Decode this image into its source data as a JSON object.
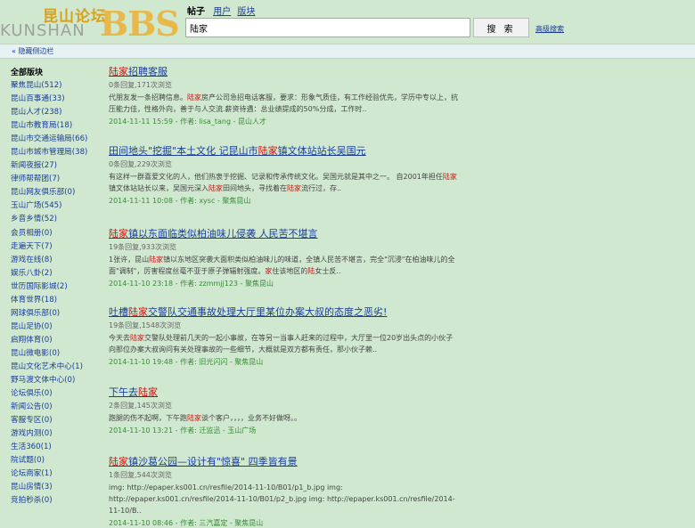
{
  "logo": {
    "cn": "昆山论坛",
    "en": "KUNSHAN",
    "bbs": "BBS"
  },
  "search": {
    "tab_active": "帖子",
    "tab_users": "用户",
    "tab_sections": "版块",
    "query": "陆家",
    "button_label": "搜 索",
    "advanced_label": "高级搜索"
  },
  "toggle": {
    "label": "« 隐藏侧边栏"
  },
  "sidebar": {
    "heading": "全部版块",
    "items": [
      "聚焦昆山(512)",
      "昆山百事通(33)",
      "昆山人才(238)",
      "昆山市教育局(18)",
      "昆山市交通运输局(66)",
      "昆山市城市管理局(38)",
      "新闻夜报(27)",
      "律师帮帮团(7)",
      "昆山网友俱乐部(0)",
      "玉山广场(545)",
      "乡音乡情(52)",
      "会员相册(0)",
      "走遍天下(7)",
      "游戏在线(8)",
      "娱乐八卦(2)",
      "世历国际影城(2)",
      "体育世界(18)",
      "网球俱乐部(0)",
      "昆山足协(0)",
      "启翔体育(0)",
      "昆山微电影(0)",
      "昆山文化艺术中心(1)",
      "野马渡文体中心(0)",
      "论坛俱乐(0)",
      "新闻公告(0)",
      "客服专区(0)",
      "游戏内测(0)",
      "生活360(1)",
      "院试题(0)",
      "论坛商家(1)",
      "昆山房情(3)",
      "竞拍秒杀(0)"
    ]
  },
  "results": [
    {
      "title_hl": "陆家",
      "title_rest": "招聘客服",
      "meta": "0条回复,171次浏览",
      "snippet": [
        {
          "t": "代朋友发一条招聘信息。"
        },
        {
          "t": "陆家",
          "hl": true
        },
        {
          "t": "房产公司急招电话客服，要求：形象气质佳，有工作经验优先，学历中专以上，抗压能力佳，性格外向，善于与人交流.薪资待遇：总业绩提成的50%分成，工作时.."
        }
      ],
      "date": "2014-11-11 15:59",
      "author": "作者: lisa_tang - 昆山人才"
    },
    {
      "title_pre": "田间地头\"挖掘\"本土文化 记昆山市",
      "title_hl": "陆家",
      "title_rest": "镇文体站站长吴国元",
      "meta": "0条回复,229次浏览",
      "snippet": [
        {
          "t": "有这样一群喜爱文化的人，他们热衷于挖掘、记录和传承传统文化。吴国元就是其中之一。        自2001年担任"
        },
        {
          "t": "陆家",
          "hl": true
        },
        {
          "t": "镇文体站站长以来，吴国元深入"
        },
        {
          "t": "陆家",
          "hl": true
        },
        {
          "t": "田间地头，寻找着在"
        },
        {
          "t": "陆家",
          "hl": true
        },
        {
          "t": "流行过，存.."
        }
      ],
      "date": "2014-11-11 10:08",
      "author": "作者: xysc - 聚焦昆山"
    },
    {
      "title_hl": "陆家",
      "title_rest": "镇以东面临类似柏油味儿侵袭 人民苦不堪言",
      "meta": "19条回复,933次浏览",
      "snippet": [
        {
          "t": "1张许，昆山"
        },
        {
          "t": "陆家",
          "hl": true
        },
        {
          "t": "镇以东地区突袭大面积类似柏油味儿的味道，全镇人民苦不堪言，完全\"沉浸\"在柏油味儿的全面\"调制\"，厉害程度丝毫不亚于原子弹辐射强度。"
        },
        {
          "t": "家",
          "hl": true
        },
        {
          "t": "住该地区的"
        },
        {
          "t": "陆",
          "hl": true
        },
        {
          "t": "女士反.."
        }
      ],
      "date": "2014-11-10 23:18",
      "author": "作者: zzmmjj123 - 聚焦昆山"
    },
    {
      "title_pre": "吐槽",
      "title_hl": "陆家",
      "title_rest": "交警队交通事故处理大厅里某位办案大叔的态度之恶劣!",
      "meta": "19条回复,1548次浏览",
      "snippet": [
        {
          "t": "今天去"
        },
        {
          "t": "陆家",
          "hl": true
        },
        {
          "t": "交警队处理前几天的一起小事故，在等另一当事人赶来的过程中，大厅里一位20岁出头点的小伙子向那位办案大叔询问有关处理事故的一些细节，大概就是双方都有责任，那小伙子赖.."
        }
      ],
      "date": "2014-11-10 19:48",
      "author": "作者: 旧光闪闪 - 聚焦昆山"
    },
    {
      "title_pre": "下午去",
      "title_hl": "陆家",
      "title_rest": "",
      "meta": "2条回复,145次浏览",
      "snippet": [
        {
          "t": "跑腿的伤不起啊，下午跑"
        },
        {
          "t": "陆家",
          "hl": true
        },
        {
          "t": "谈个客户，，，，业务不好做呀。。"
        }
      ],
      "date": "2014-11-10 13:21",
      "author": "作者: 迁监迅 - 玉山广场"
    },
    {
      "title_hl": "陆家",
      "title_rest": "镇沙葛公园—设计有\"惊喜\" 四季皆有景",
      "meta": "1条回复,544次浏览",
      "snippet": [
        {
          "t": "img: http://epaper.ks001.cn/resfile/2014-11-10/B01/p1_b.jpg img: http://epaper.ks001.cn/resfile/2014-11-10/B01/p2_b.jpg img: http://epaper.ks001.cn/resfile/2014-11-10/B.."
        }
      ],
      "date": "2014-11-10 08:46",
      "author": "作者: 三汽嘉定 - 聚焦昆山"
    }
  ]
}
